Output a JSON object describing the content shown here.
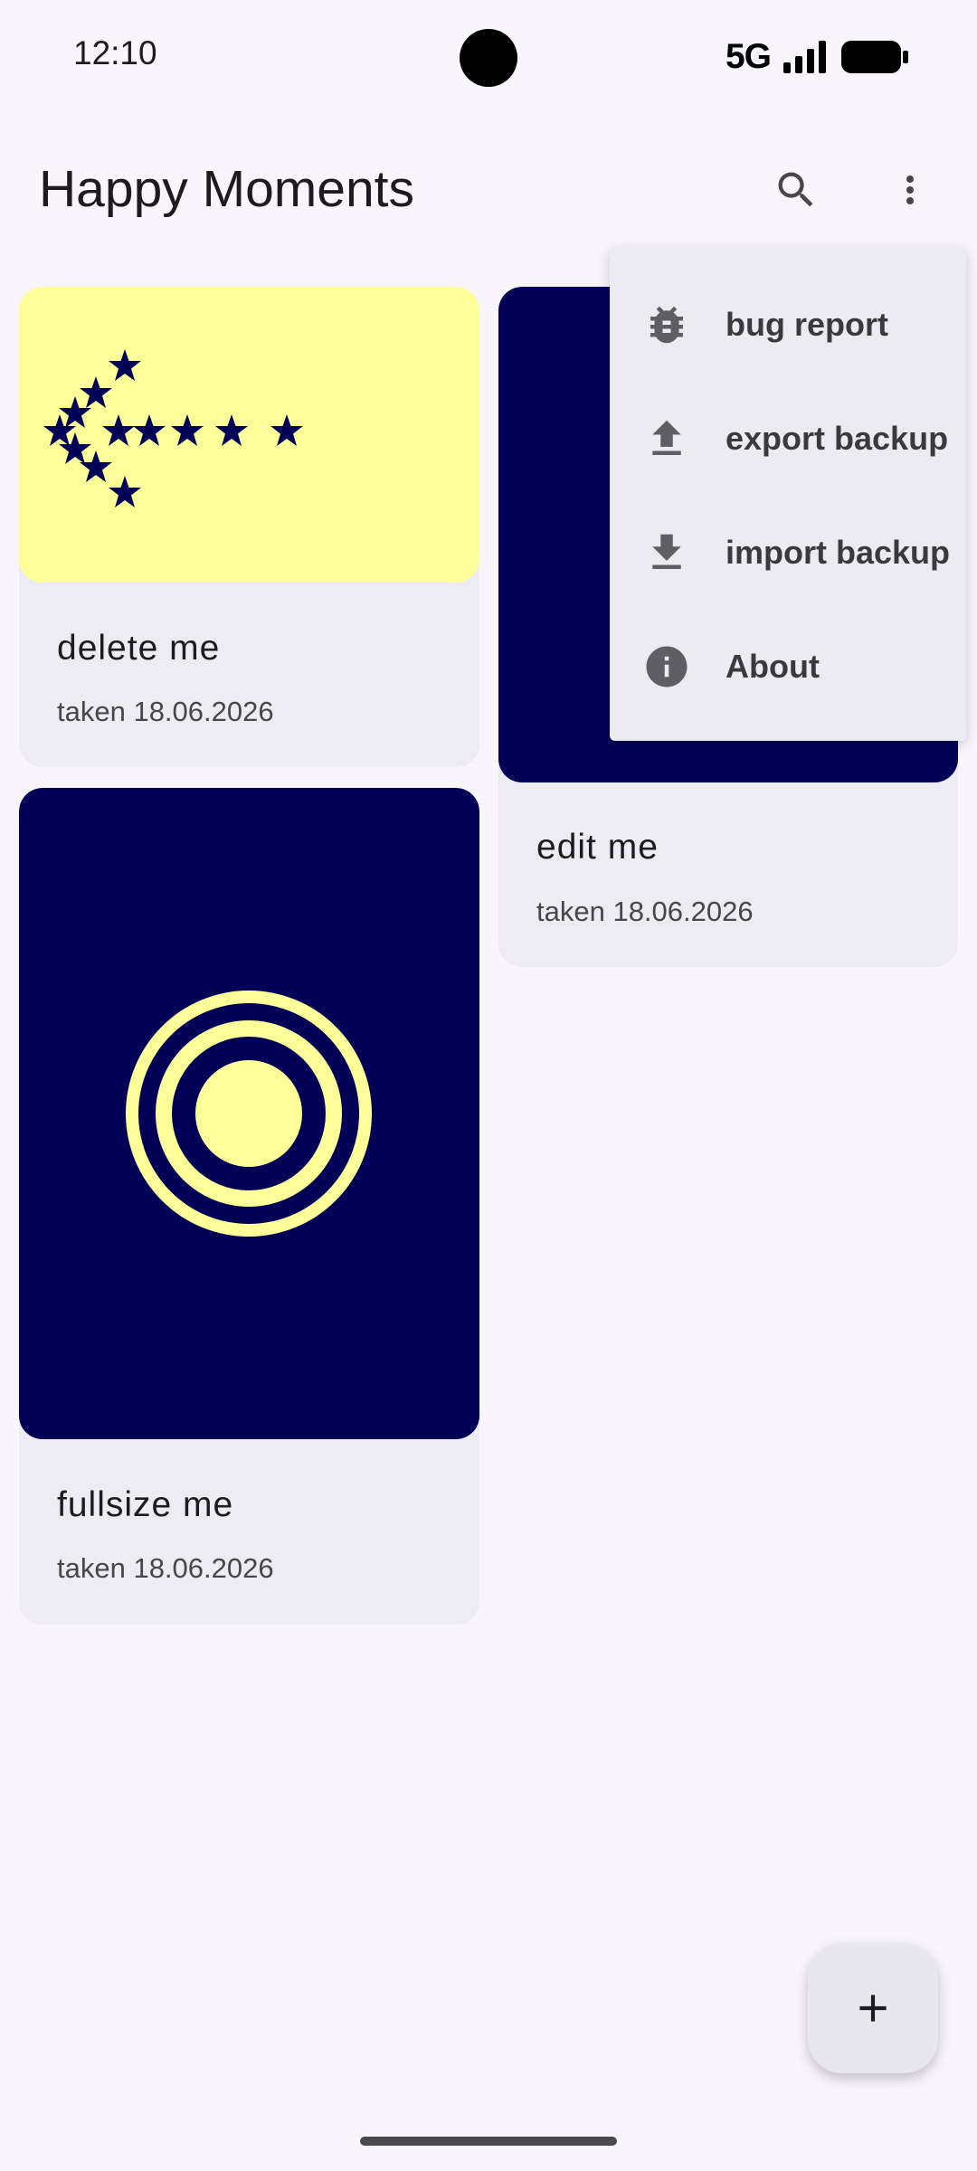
{
  "status_bar": {
    "time": "12:10",
    "network": "5G"
  },
  "app_bar": {
    "title": "Happy Moments",
    "actions": [
      {
        "icon": "search-icon"
      },
      {
        "icon": "more-vert-icon"
      }
    ]
  },
  "cards": [
    {
      "title": "delete me",
      "date": "taken 18.06.2026",
      "image": "yellow-stars-arrow"
    },
    {
      "title": "edit me",
      "date": "taken 18.06.2026",
      "image": "navy-solid"
    },
    {
      "title": "fullsize me",
      "date": "taken 18.06.2026",
      "image": "navy-concentric-circles"
    }
  ],
  "menu": {
    "items": [
      {
        "label": "bug report",
        "icon": "bug-icon"
      },
      {
        "label": "export backup",
        "icon": "upload-icon"
      },
      {
        "label": "import backup",
        "icon": "download-icon"
      },
      {
        "label": "About",
        "icon": "info-icon"
      }
    ]
  },
  "fab": {
    "icon": "add-icon"
  },
  "colors": {
    "background": "#f8f5fc",
    "card": "#edebf4",
    "navy": "#010057",
    "yellow": "#ffff99"
  }
}
